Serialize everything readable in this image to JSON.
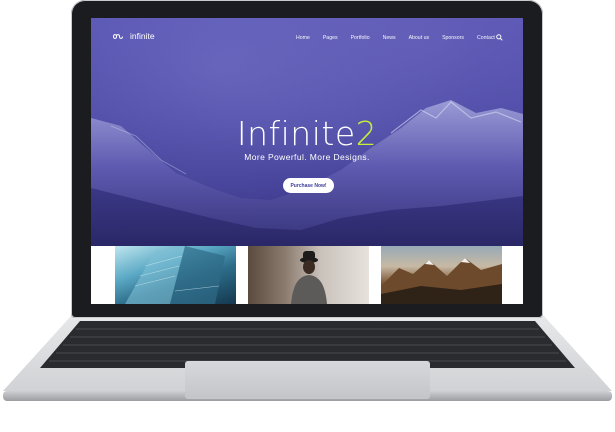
{
  "site": {
    "logo_text": "infinite",
    "nav": [
      "Home",
      "Pages",
      "Portfolio",
      "News",
      "About us",
      "Sponsors",
      "Contact"
    ],
    "hero_title": "Infinite",
    "hero_title_number": "2",
    "hero_subtitle": "More Powerful. More Designs.",
    "cta_label": "Purchase Now!"
  },
  "icons": {
    "logo": "infinity-icon",
    "search": "search-icon"
  },
  "colors": {
    "hero": "#4d4aa6",
    "accent": "#c6ef3a",
    "device_bezel": "#1b1c1f",
    "device_body": "#c9cacd"
  }
}
